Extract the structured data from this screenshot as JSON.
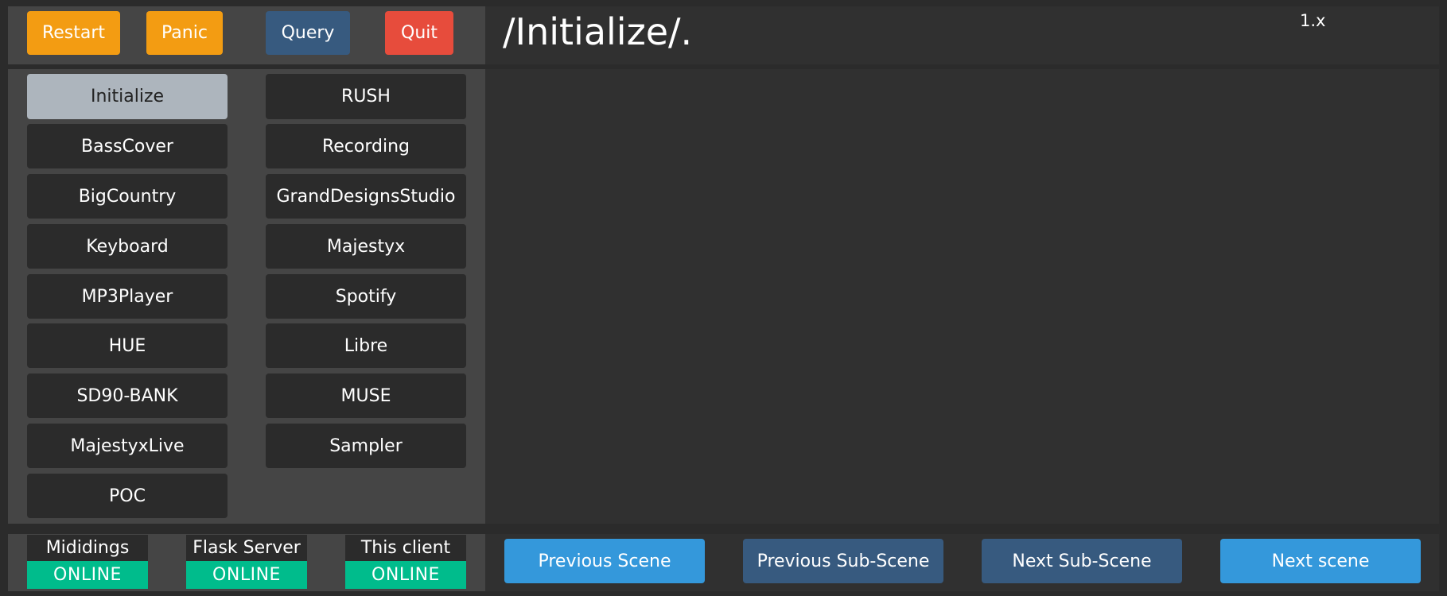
{
  "toolbar": {
    "restart_label": "Restart",
    "panic_label": "Panic",
    "query_label": "Query",
    "quit_label": "Quit"
  },
  "header": {
    "title": "/Initialize/.",
    "version": "1.x"
  },
  "scenes": {
    "active": "Initialize",
    "column1": [
      "Initialize",
      "BassCover",
      "BigCountry",
      "Keyboard",
      "MP3Player",
      "HUE",
      "SD90-BANK",
      "MajestyxLive",
      "POC"
    ],
    "column2": [
      "RUSH",
      "Recording",
      "GrandDesignsStudio",
      "Majestyx",
      "Spotify",
      "Libre",
      "MUSE",
      "Sampler"
    ]
  },
  "status": [
    {
      "name": "Mididings",
      "state": "ONLINE"
    },
    {
      "name": "Flask Server",
      "state": "ONLINE"
    },
    {
      "name": "This client",
      "state": "ONLINE"
    }
  ],
  "navigation": {
    "previous_scene": "Previous Scene",
    "previous_subscene": "Previous Sub-Scene",
    "next_subscene": "Next Sub-Scene",
    "next_scene": "Next scene"
  },
  "colors": {
    "orange": "#f39c12",
    "steel": "#375a7f",
    "red": "#e74c3c",
    "blue": "#3498db",
    "online_green": "#00bc8c",
    "active_scene": "#adb5bd"
  }
}
